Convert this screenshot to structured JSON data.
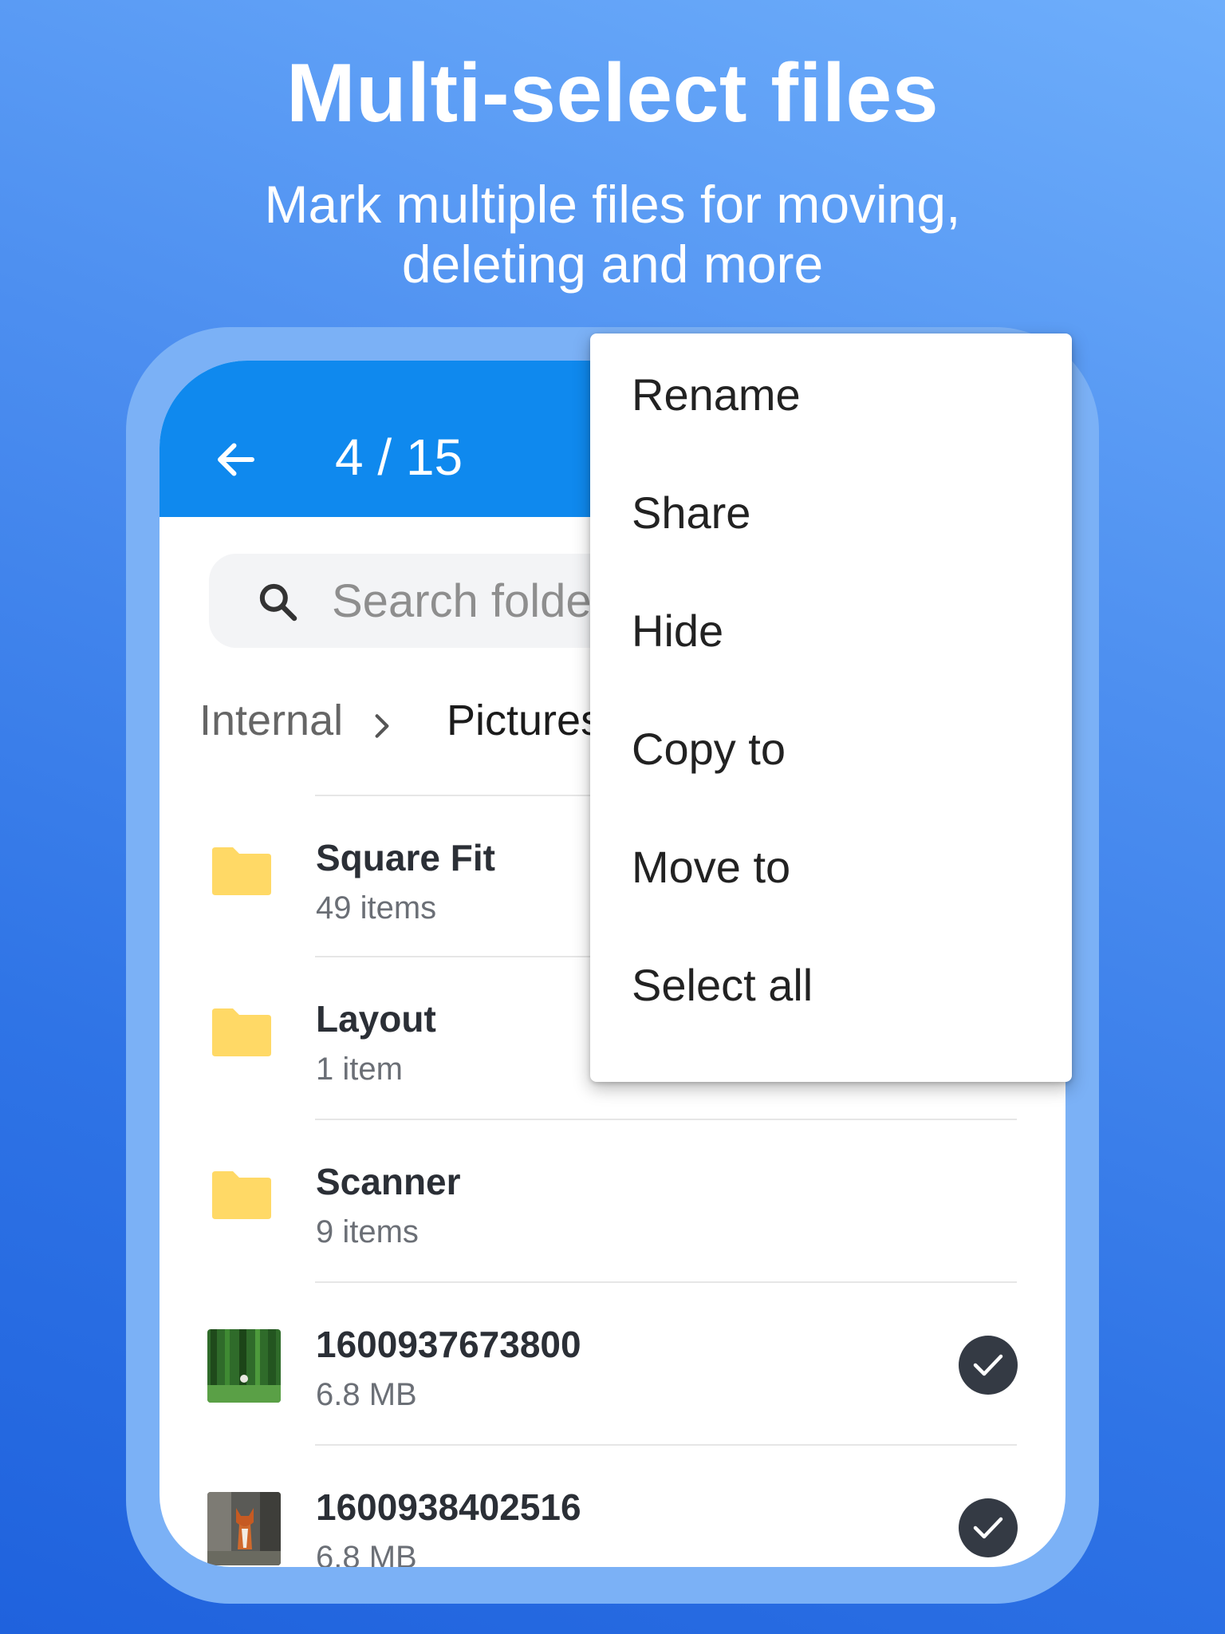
{
  "promo": {
    "headline": "Multi-select files",
    "subline_1": "Mark multiple files for moving,",
    "subline_2": "deleting and more"
  },
  "appbar": {
    "selection_count": "4 / 15",
    "back_icon": "arrow-left-icon",
    "color": "#0f89ee"
  },
  "search": {
    "placeholder": "Search folder",
    "icon": "search-icon"
  },
  "breadcrumb": {
    "items": [
      "Internal",
      "Pictures"
    ],
    "separator_icon": "chevron-right-icon"
  },
  "files": [
    {
      "name": "Square Fit",
      "meta": "49 items",
      "kind": "folder",
      "selected": false
    },
    {
      "name": "Layout",
      "meta": "1 item",
      "kind": "folder",
      "selected": false
    },
    {
      "name": "Scanner",
      "meta": "9 items",
      "kind": "folder",
      "selected": false
    },
    {
      "name": "1600937673800",
      "meta": "6.8 MB",
      "kind": "image",
      "selected": true
    },
    {
      "name": "1600938402516",
      "meta": "6.8 MB",
      "kind": "image",
      "selected": true
    }
  ],
  "menu": {
    "items": [
      "Rename",
      "Share",
      "Hide",
      "Copy to",
      "Move to",
      "Select all"
    ]
  },
  "colors": {
    "folder": "#ffd966",
    "check_bg": "#343a44"
  }
}
